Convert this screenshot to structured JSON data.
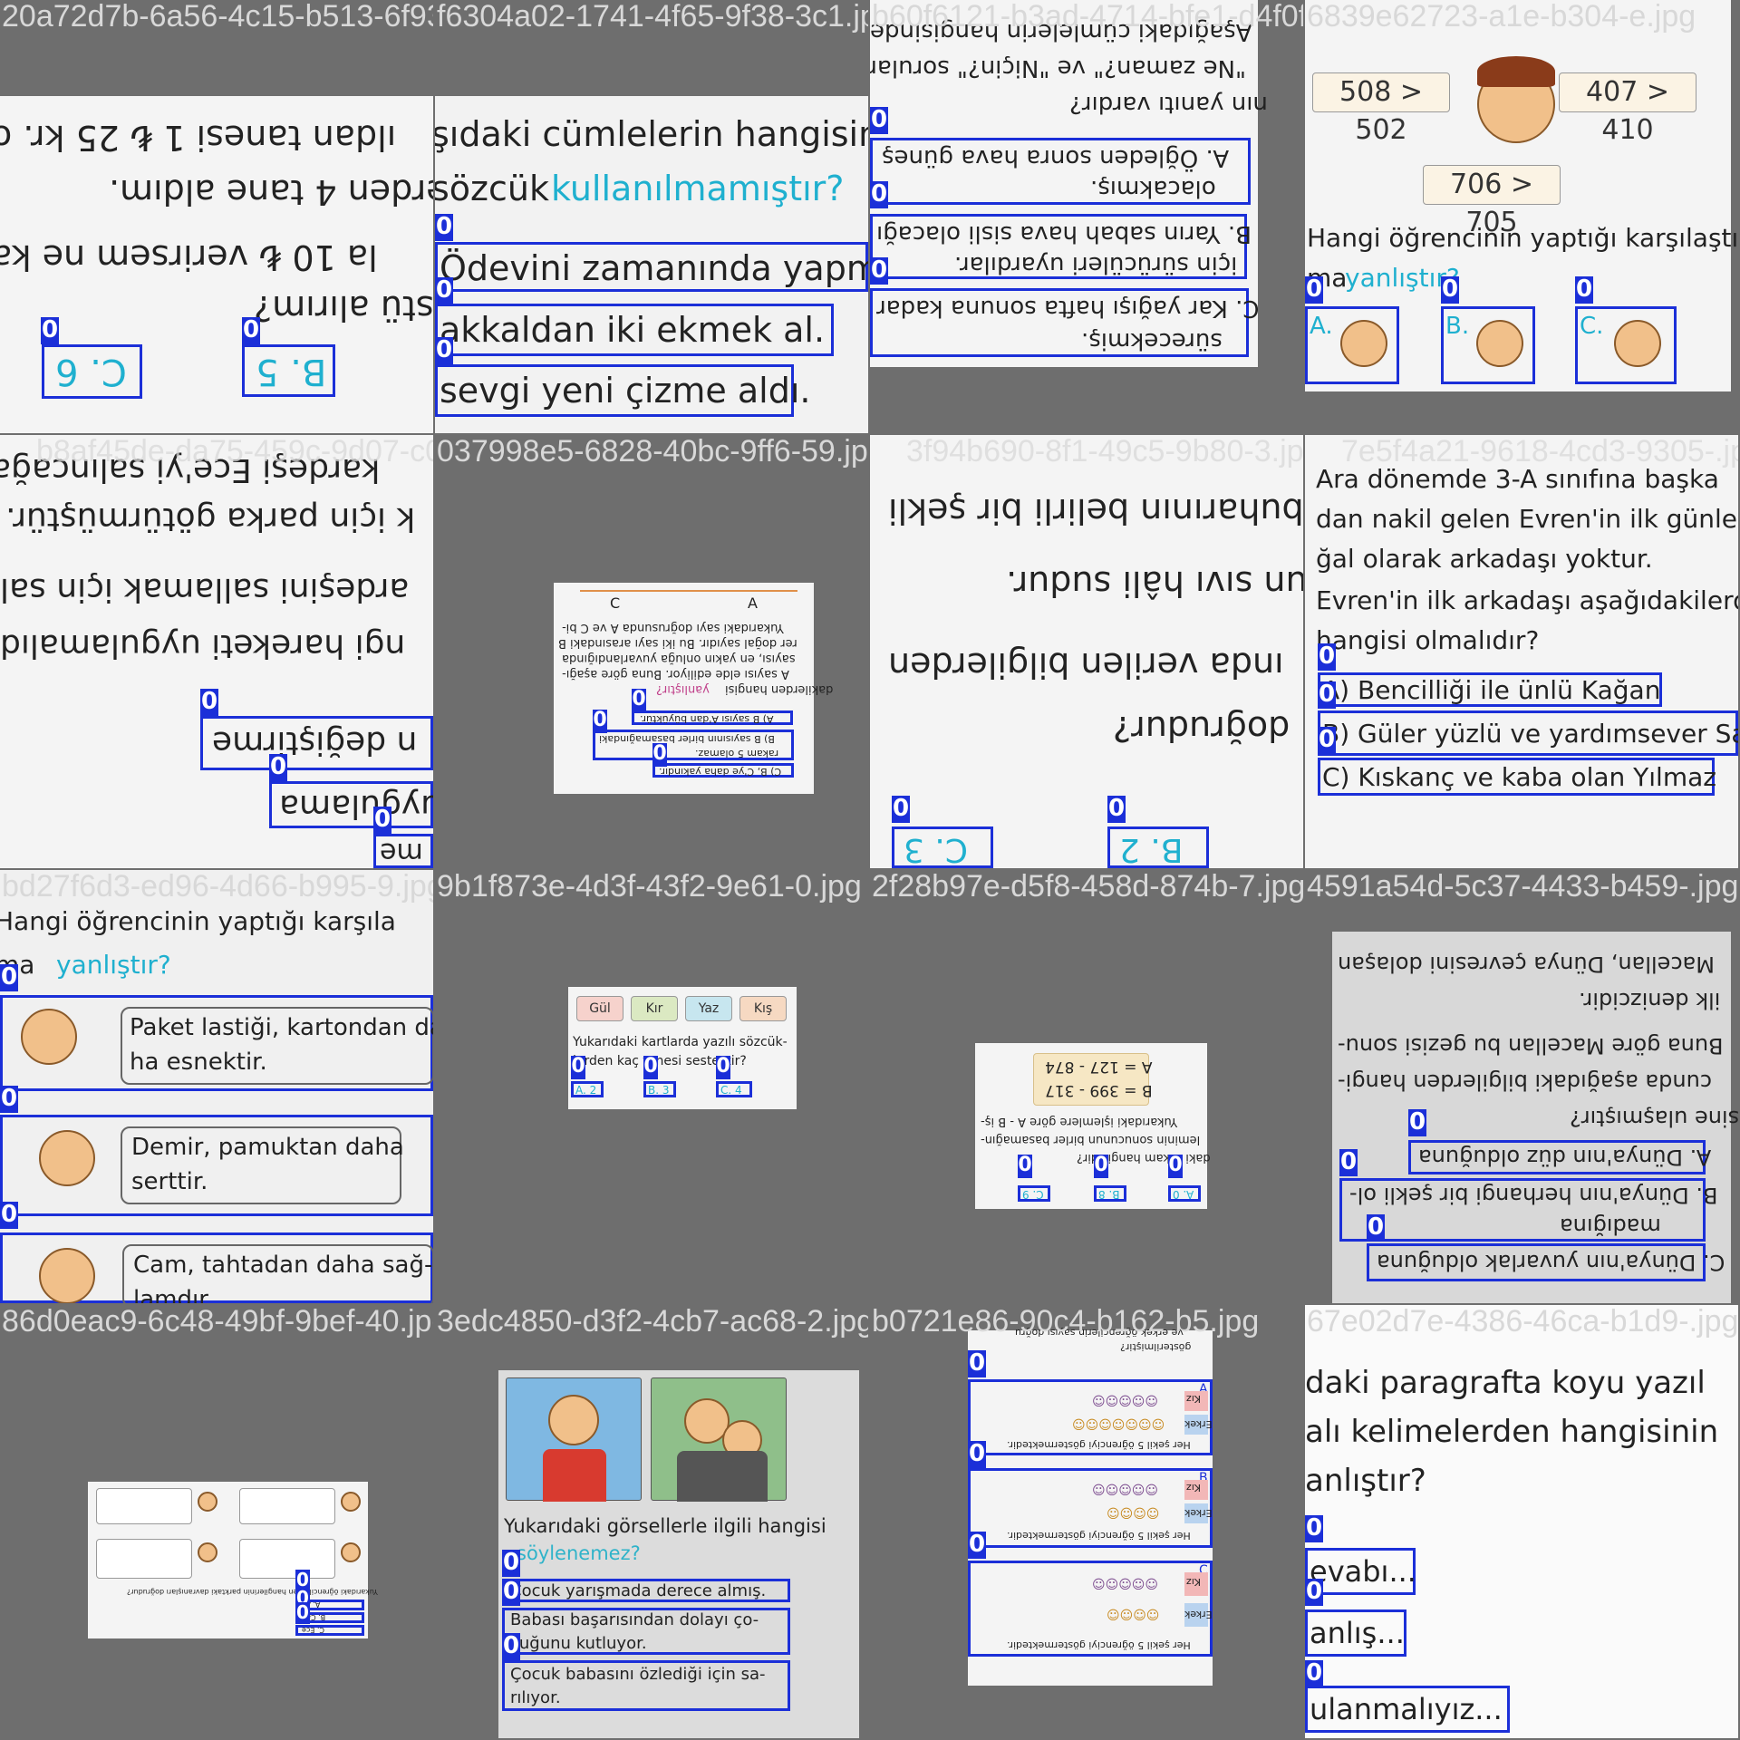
{
  "tiles": [
    {
      "caption": "20a72d7b-6a56-4c15-b513-6f939ae9217a1.jpg",
      "lines": [
        "ıldan tanesi 1 ₺ 25 kr. o",
        "erden 4 tane aldım.",
        "la 10 ₺ verirsem ne ka",
        "üstü alırım?"
      ],
      "options": [
        "C. 6",
        "B. 5"
      ],
      "labels": [
        "0",
        "0"
      ]
    },
    {
      "caption": "f6304a02-1741-4f65-9f38-3c1.jpg",
      "lines": [
        "şıdaki cümlelerin hangisind",
        "sözcük"
      ],
      "highlight": "kullanılmamıştır?",
      "options": [
        "Ödevini zamanında yapm",
        "akkaldan iki ekmek al.",
        "sevgi yeni çizme aldı."
      ],
      "labels": [
        "0",
        "0",
        "0"
      ]
    },
    {
      "caption": "b60f6121-b3ad-4714-bfe1-d4f0f.jpg",
      "lines": [
        "Aşağıdaki cümlelerin hangisinde",
        "\"Ne zaman?\" ve \"Niçin?\" soruları",
        "nın yanıtı vardır?"
      ],
      "options": [
        "A. Öğleden sonra hava güneş",
        "olacakmış.",
        "B. Yarın sabah hava sisli olacağı",
        "için sürücüleri uyardılar.",
        "C. Kar yağışı hafta sonuna kadar",
        "sürecekmiş."
      ],
      "labels": [
        "0",
        "0",
        "0"
      ]
    },
    {
      "caption": "6839e62723-a1e-b304-e.jpg",
      "cards": [
        "508 > 502",
        "407 > 410",
        "706 > 705"
      ],
      "question": "Hangi öğrencinin yaptığı karşılaştır-",
      "q2a": "ma",
      "q2b": "yanlıştır?",
      "options": [
        "A.",
        "B.",
        "C."
      ],
      "labels": [
        "0",
        "0",
        "0"
      ]
    },
    {
      "caption": "b8af45de-da75-459c-9d07-c0.jpg",
      "lines": [
        "kardeşi Ece'yi salıncağa",
        "k için parka götürmüştür.",
        "ardeşini sallamak için sal",
        "ngi hareketi uygulamalıdı"
      ],
      "options": [
        "n değiştirme",
        "uygulama",
        "me"
      ],
      "labels": [
        "0",
        "0",
        "0"
      ]
    },
    {
      "caption": "037998e5-6828-40bc-9ff6-59.jpg",
      "axis": [
        "C",
        "A"
      ],
      "lines": [
        "Yukarıdaki sayı doğrusunda A ve C bi-",
        "rer doğal sayıdır. Bu iki sayı arasındaki B",
        "sayısı, en yakın onluğa yuvarlandığında",
        "A sayısı elde ediliyor. Buna göre aşağı-",
        "dakilerden hangisi"
      ],
      "hl": "yanlıştır?",
      "options": [
        "A) B sayısı A'dan büyüktür.",
        "B) B sayısının birler basamağındaki",
        "rakam 5 olamaz.",
        "C) B, C'ye daha yakındır."
      ],
      "labels": [
        "0",
        "0",
        "0"
      ]
    },
    {
      "caption": "3f94b690-8f1-49c5-9b80-3.jpg",
      "lines": [
        "buharının belirli bir şekli",
        "zun sıvı hâli sudur.",
        "ında verilen bilgilerden",
        "doğrudur?"
      ],
      "options": [
        "C. 3",
        "B. 2"
      ],
      "labels": [
        "0",
        "0"
      ]
    },
    {
      "caption": "7e5f4a21-9618-4cd3-9305-.jpg",
      "lines": [
        "Ara dönemde 3-A sınıfına başka",
        "dan nakil gelen Evren'in ilk günlerde",
        "ğal olarak arkadaşı yoktur.",
        "Evren'in ilk arkadaşı aşağıdakilerden",
        "hangisi olmalıdır?"
      ],
      "options": [
        "A) Bencilliği ile ünlü Kağan",
        "B) Güler yüzlü ve yardımsever Sal",
        "C) Kıskanç ve kaba olan Yılmaz"
      ],
      "labels": [
        "0",
        "0",
        "0"
      ]
    },
    {
      "caption": "bd27f6d3-ed96-4d66-b995-9.jpg",
      "lines": [
        "Hangi öğrencinin yaptığı karşıla"
      ],
      "q2a": "ma",
      "q2b": "yanlıştır?",
      "options": [
        "Paket lastiği, kartondan da",
        "ha esnektir.",
        "Demir, pamuktan daha",
        "serttir.",
        "Cam, tahtadan daha sağ-",
        "lamdır."
      ],
      "labels": [
        "0",
        "0",
        "0"
      ]
    },
    {
      "caption": "9b1f873e-4d3f-43f2-9e61-0.jpg",
      "cards": [
        "Gül",
        "Kır",
        "Yaz",
        "Kış"
      ],
      "lines": [
        "Yukarıdaki kartlarda yazılı sözcük-",
        "lerden kaç tanesi sesteştir?"
      ],
      "options": [
        "A. 2",
        "B. 3",
        "C. 4"
      ],
      "labels": [
        "0",
        "0",
        "0"
      ]
    },
    {
      "caption": "2f28b97e-d5f8-458d-874b-7.jpg",
      "ops": [
        "A = 127 - 874",
        "B = 399 - 317"
      ],
      "lines": [
        "Yukarıdaki işlemlere göre A - B iş-",
        "leminin sonucunun birler basamağın-",
        "daki rakam hangisidir?"
      ],
      "options": [
        "C. 9",
        "B. 8",
        "A. 0"
      ],
      "labels": [
        "0",
        "0",
        "0"
      ]
    },
    {
      "caption": "4591a54d-5c37-4433-b459-.jpg",
      "lines": [
        "Macellan, Dünya çevresini dolaşan",
        "ilk denizcidir.",
        "Buna göre Macellan bu gezisi sonu-",
        "cunda aşağıdaki bilgilerden hangi-",
        "sine ulaşmıştır?"
      ],
      "options": [
        "A. Dünya'nın düz olduğuna",
        "B. Dünya'nın herhangi bir şekli ol-",
        "madığına",
        "C. Dünya'nın yuvarlak olduğuna"
      ],
      "labels": [
        "0",
        "0",
        "0"
      ]
    },
    {
      "caption": "86d0eac9-6c48-49bf-9bef-40.jpg",
      "lines": [
        "Yukarıdaki öğrencilerden hangilerinin parktaki davranışları doğrudur?"
      ],
      "options": [
        "A. Ali",
        "B. Can",
        "C. Ece"
      ],
      "labels": [
        "0",
        "0",
        "0"
      ]
    },
    {
      "caption": "3edc4850-d3f2-4cb7-ac68-2.jpg",
      "lines": [
        "Yukarıdaki görsellerle ilgili hangisi"
      ],
      "hl": "söylenemez?",
      "options": [
        "Çocuk yarışmada derece almış.",
        "Babası başarısından dolayı ço-",
        "cuğunu kutluyor.",
        "Çocuk babasını özlediği için sa-",
        "rılıyor."
      ],
      "labels": [
        "0",
        "0",
        "0"
      ]
    },
    {
      "caption": "b0721e86-90c4-b162-b5.jpg",
      "lines": [
        "Her şekil 5 öğrenciyi göstermektedir.",
        "ve erkek öğrencilerin sayısı doğru",
        "gösterilmiştir?"
      ],
      "rows": [
        "Kız",
        "Erkek"
      ],
      "labels": [
        "0",
        "0",
        "0"
      ],
      "tags": [
        "A",
        "B",
        "C"
      ]
    },
    {
      "caption": "67e02d7e-4386-46ca-b1d9-.jpg",
      "lines": [
        "daki paragrafta koyu yazıl",
        "alı kelimelerden hangisinin",
        "anlıştır?"
      ],
      "options": [
        "evabı...",
        "anlış...",
        "ulanmalıyız..."
      ],
      "labels": [
        "0",
        "0",
        "0"
      ]
    }
  ]
}
